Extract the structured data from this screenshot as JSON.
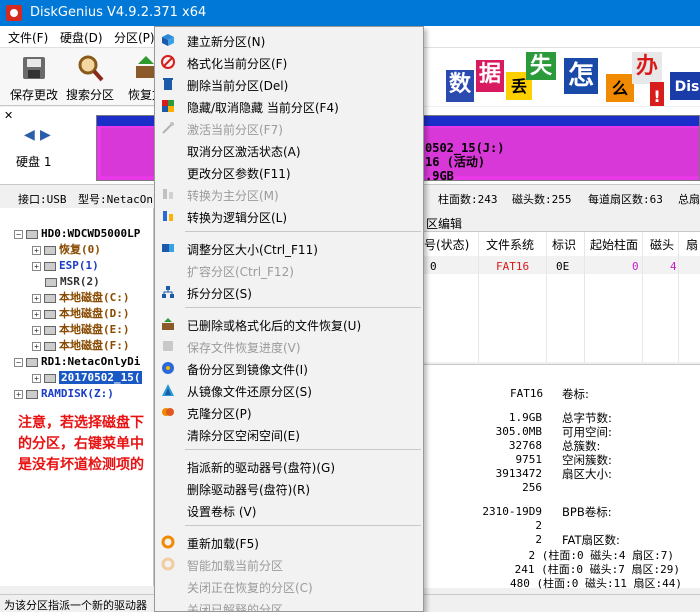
{
  "window": {
    "title": "DiskGenius V4.9.2.371 x64"
  },
  "menubar": [
    {
      "label": "文件(F)"
    },
    {
      "label": "硬盘(D)"
    },
    {
      "label": "分区(P)"
    }
  ],
  "toolbar": [
    {
      "label": "保存更改",
      "icon": "save-disk-icon"
    },
    {
      "label": "搜索分区",
      "icon": "magnifier-icon"
    },
    {
      "label": "恢复文",
      "icon": "recover-icon"
    }
  ],
  "banner": {
    "chars": [
      "数",
      "据",
      "丢",
      "失",
      "怎",
      "么",
      "办",
      "!",
      "Dis"
    ]
  },
  "disk_panel": {
    "disk_label": "硬盘 1",
    "partition_text": [
      "0502_15(J:)",
      "16 (活动)",
      ".9GB"
    ]
  },
  "info_strip": {
    "interface": "接口:USB",
    "model": "型号:NetacOnl",
    "cylinders": "柱面数:243",
    "heads": "磁头数:255",
    "sectors_per_track": "每道扇区数:63",
    "total": "总扇"
  },
  "tree": [
    {
      "pm": "-",
      "label": "HD0:WDCWD5000LP",
      "color": "black",
      "indent": 0
    },
    {
      "pm": "+",
      "label": "恢复(0)",
      "color": "brown",
      "indent": 1
    },
    {
      "pm": "+",
      "label": "ESP(1)",
      "color": "blue",
      "indent": 1
    },
    {
      "pm": "",
      "label": "MSR(2)",
      "color": "gray",
      "indent": 1
    },
    {
      "pm": "+",
      "label": "本地磁盘(C:)",
      "color": "brown",
      "indent": 1
    },
    {
      "pm": "+",
      "label": "本地磁盘(D:)",
      "color": "brown",
      "indent": 1
    },
    {
      "pm": "+",
      "label": "本地磁盘(E:)",
      "color": "brown",
      "indent": 1
    },
    {
      "pm": "+",
      "label": "本地磁盘(F:)",
      "color": "brown",
      "indent": 1
    },
    {
      "pm": "-",
      "label": "RD1:NetacOnlyDi",
      "color": "black",
      "indent": 0
    },
    {
      "pm": "+",
      "label": "20170502_15(",
      "color": "selected",
      "indent": 1
    },
    {
      "pm": "",
      "label": "RAMDISK(Z:)",
      "color": "blue",
      "indent": 0
    }
  ],
  "note": "注意，若选择磁盘下的分区，右键菜单中是没有坏道检测项的",
  "partition_tab": "区编辑",
  "partition_table": {
    "headers": [
      "号(状态)",
      "文件系统",
      "标识",
      "起始柱面",
      "磁头",
      "扇"
    ],
    "row": [
      "0",
      "FAT16",
      "0E",
      "0",
      "4",
      ""
    ]
  },
  "partition_info": {
    "fs_value": "FAT16",
    "volume_label": "卷标:",
    "size_values": [
      "1.9GB",
      "305.0MB",
      "32768",
      "9751",
      "3913472",
      "256"
    ],
    "size_labels": [
      "总字节数:",
      "可用空间:",
      "总簇数:",
      "空闲簇数:",
      "扇区大小:"
    ],
    "serial": "2310-19D9",
    "bpb_label": "BPB卷标:",
    "small_values": [
      "2",
      "2"
    ],
    "fat_label": "FAT扇区数:",
    "chs_rows": [
      "2 (柱面:0 磁头:4 扇区:7)",
      "241 (柱面:0 磁头:7 扇区:29)",
      "480 (柱面:0 磁头:11 扇区:44)"
    ]
  },
  "status": "为该分区指派一个新的驱动器",
  "context_menu": [
    {
      "label": "建立新分区(N)",
      "enabled": true,
      "icon": "new-partition-icon"
    },
    {
      "label": "格式化当前分区(F)",
      "enabled": true,
      "icon": "format-icon"
    },
    {
      "label": "删除当前分区(Del)",
      "enabled": true,
      "icon": "delete-icon"
    },
    {
      "label": "隐藏/取消隐藏 当前分区(F4)",
      "enabled": true,
      "icon": "hide-icon"
    },
    {
      "label": "激活当前分区(F7)",
      "enabled": false,
      "icon": "activate-icon"
    },
    {
      "label": "取消分区激活状态(A)",
      "enabled": true,
      "icon": ""
    },
    {
      "label": "更改分区参数(F11)",
      "enabled": true,
      "icon": ""
    },
    {
      "label": "转换为主分区(M)",
      "enabled": false,
      "icon": "convert-primary-icon"
    },
    {
      "label": "转换为逻辑分区(L)",
      "enabled": true,
      "icon": "convert-logical-icon"
    },
    {
      "label": "调整分区大小(Ctrl_F11)",
      "enabled": true,
      "icon": "resize-icon"
    },
    {
      "label": "扩容分区(Ctrl_F12)",
      "enabled": false,
      "icon": ""
    },
    {
      "label": "拆分分区(S)",
      "enabled": true,
      "icon": "split-icon"
    },
    {
      "label": "已删除或格式化后的文件恢复(U)",
      "enabled": true,
      "icon": "file-recovery-icon"
    },
    {
      "label": "保存文件恢复进度(V)",
      "enabled": false,
      "icon": ""
    },
    {
      "label": "备份分区到镜像文件(I)",
      "enabled": true,
      "icon": "backup-image-icon"
    },
    {
      "label": "从镜像文件还原分区(S)",
      "enabled": true,
      "icon": "restore-image-icon"
    },
    {
      "label": "克隆分区(P)",
      "enabled": true,
      "icon": "clone-icon"
    },
    {
      "label": "清除分区空闲空间(E)",
      "enabled": true,
      "icon": ""
    },
    {
      "label": "指派新的驱动器号(盘符)(G)",
      "enabled": true,
      "icon": ""
    },
    {
      "label": "删除驱动器号(盘符)(R)",
      "enabled": true,
      "icon": ""
    },
    {
      "label": "设置卷标 (V)",
      "enabled": true,
      "icon": ""
    },
    {
      "label": "重新加载(F5)",
      "enabled": true,
      "icon": "reload-icon"
    },
    {
      "label": "智能加载当前分区",
      "enabled": false,
      "icon": "smart-load-icon"
    },
    {
      "label": "关闭正在恢复的分区(C)",
      "enabled": false,
      "icon": ""
    },
    {
      "label": "关闭已解释的分区",
      "enabled": false,
      "icon": ""
    }
  ],
  "colors": {
    "titlebar": "#0078d7",
    "partition_fill": "#d838d8",
    "disk_header": "#1c2ec8",
    "note_red": "#e81212",
    "selection": "#1a58c4"
  }
}
